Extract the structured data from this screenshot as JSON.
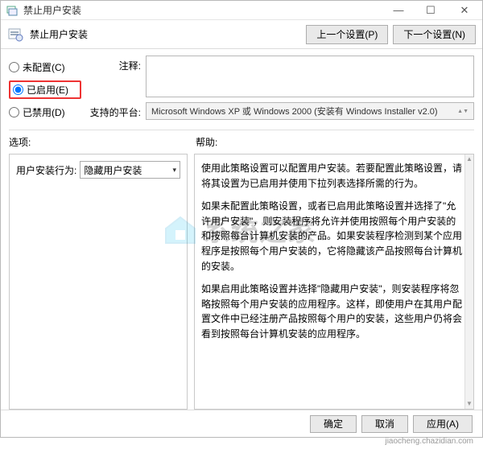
{
  "window": {
    "title": "禁止用户安装",
    "header_title": "禁止用户安装",
    "btn_prev": "上一个设置(P)",
    "btn_next": "下一个设置(N)",
    "min_glyph": "—",
    "max_glyph": "☐",
    "close_glyph": "✕"
  },
  "config": {
    "not_configured": "未配置(C)",
    "enabled": "已启用(E)",
    "disabled": "已禁用(D)",
    "selected": "enabled"
  },
  "annot": {
    "label": "注释:",
    "supported_label": "支持的平台:",
    "supported_value": "Microsoft Windows XP 或 Windows 2000 (安装有 Windows Installer v2.0)"
  },
  "sections": {
    "options": "选项:",
    "help": "帮助:"
  },
  "options": {
    "behavior_label": "用户安装行为:",
    "behavior_value": "隐藏用户安装"
  },
  "help": {
    "p1": "使用此策略设置可以配置用户安装。若要配置此策略设置，请将其设置为已启用并使用下拉列表选择所需的行为。",
    "p2": "如果未配置此策略设置，或者已启用此策略设置并选择了\"允许用户安装\"，则安装程序将允许并使用按照每个用户安装的和按照每台计算机安装的产品。如果安装程序检测到某个应用程序是按照每个用户安装的，它将隐藏该产品按照每台计算机的安装。",
    "p3": "如果启用此策略设置并选择\"隐藏用户安装\"，则安装程序将忽略按照每个用户安装的应用程序。这样，即使用户在其用户配置文件中已经注册产品按照每个用户的安装，这些用户仍将会看到按照每台计算机安装的应用程序。"
  },
  "footer": {
    "ok": "确定",
    "cancel": "取消",
    "apply": "应用(A)"
  },
  "watermark": {
    "brand": "系统之家",
    "url": "jiaocheng.chazidian.com"
  }
}
